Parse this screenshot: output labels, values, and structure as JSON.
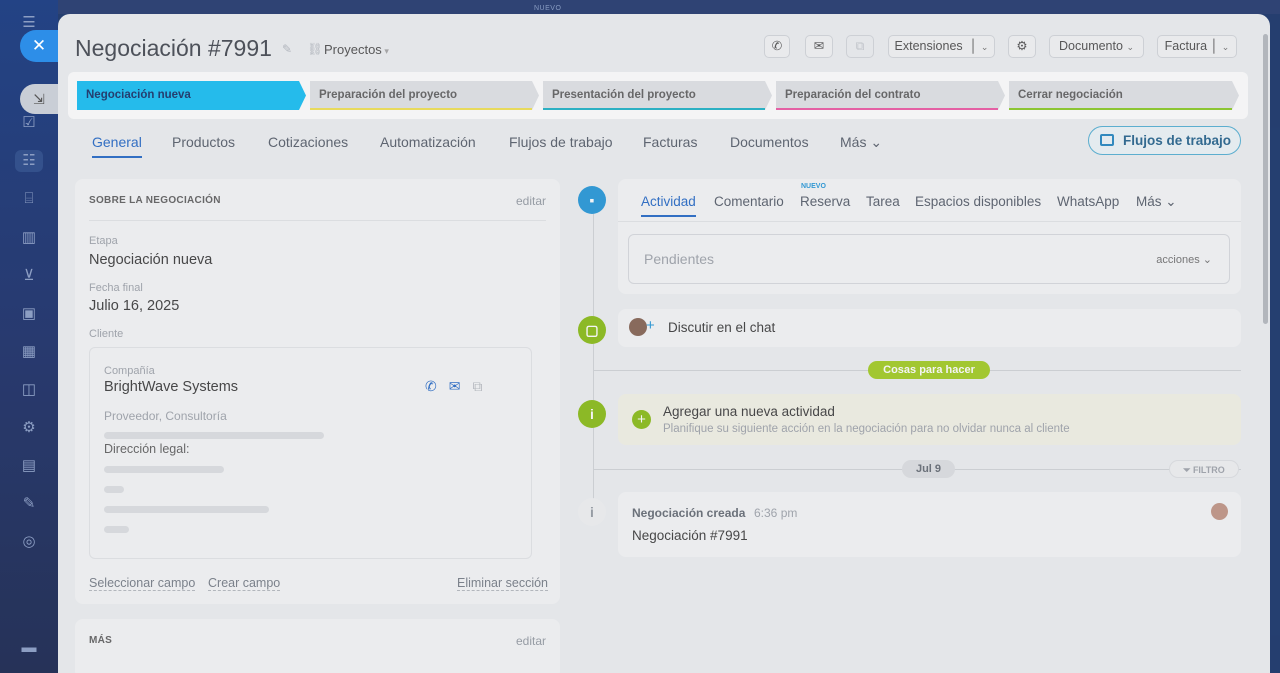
{
  "window": {
    "top_badge": "NUEVO"
  },
  "header": {
    "title": "Negociación #7991",
    "category": "Proyectos",
    "buttons": {
      "extensiones": "Extensiones",
      "documento": "Documento",
      "factura": "Factura"
    }
  },
  "stages": [
    {
      "label": "Negociación nueva",
      "color": "#1fc2f5",
      "active": true
    },
    {
      "label": "Preparación del proyecto",
      "color": "#f2e35a"
    },
    {
      "label": "Presentación del proyecto",
      "color": "#27b6c9"
    },
    {
      "label": "Preparación del contrato",
      "color": "#ee5fa8"
    },
    {
      "label": "Cerrar negociación",
      "color": "#8fcc2d"
    }
  ],
  "tabs": [
    "General",
    "Productos",
    "Cotizaciones",
    "Automatización",
    "Flujos de trabajo",
    "Facturas",
    "Documentos",
    "Más"
  ],
  "flujos_button": "Flujos de trabajo",
  "about": {
    "title": "SOBRE LA NEGOCIACIÓN",
    "edit": "editar",
    "stage_label": "Etapa",
    "stage_value": "Negociación nueva",
    "date_label": "Fecha final",
    "date_value": "Julio 16, 2025",
    "client_label": "Cliente",
    "company": {
      "label": "Compañía",
      "name": "BrightWave Systems",
      "type": "Proveedor, Consultoría",
      "address_label": "Dirección legal:"
    },
    "links": {
      "select": "Seleccionar campo",
      "create": "Crear campo",
      "delete": "Eliminar sección"
    }
  },
  "more_card": {
    "title": "MÁS",
    "edit": "editar"
  },
  "activity": {
    "tabs": [
      "Actividad",
      "Comentario",
      "Reserva",
      "Tarea",
      "Espacios disponibles",
      "WhatsApp",
      "Más"
    ],
    "nuevo_badge": "NUEVO",
    "pending_placeholder": "Pendientes",
    "acciones": "acciones",
    "chat_label": "Discutir en el chat",
    "todo_pill": "Cosas para hacer",
    "new_activity_title": "Agregar una nueva actividad",
    "new_activity_sub": "Planifique su siguiente acción en la negociación para no olvidar nunca al cliente",
    "date_pill": "Jul 9",
    "filter": "FILTRO",
    "created_title": "Negociación creada",
    "created_time": "6:36 pm",
    "created_body": "Negociación #7991"
  }
}
